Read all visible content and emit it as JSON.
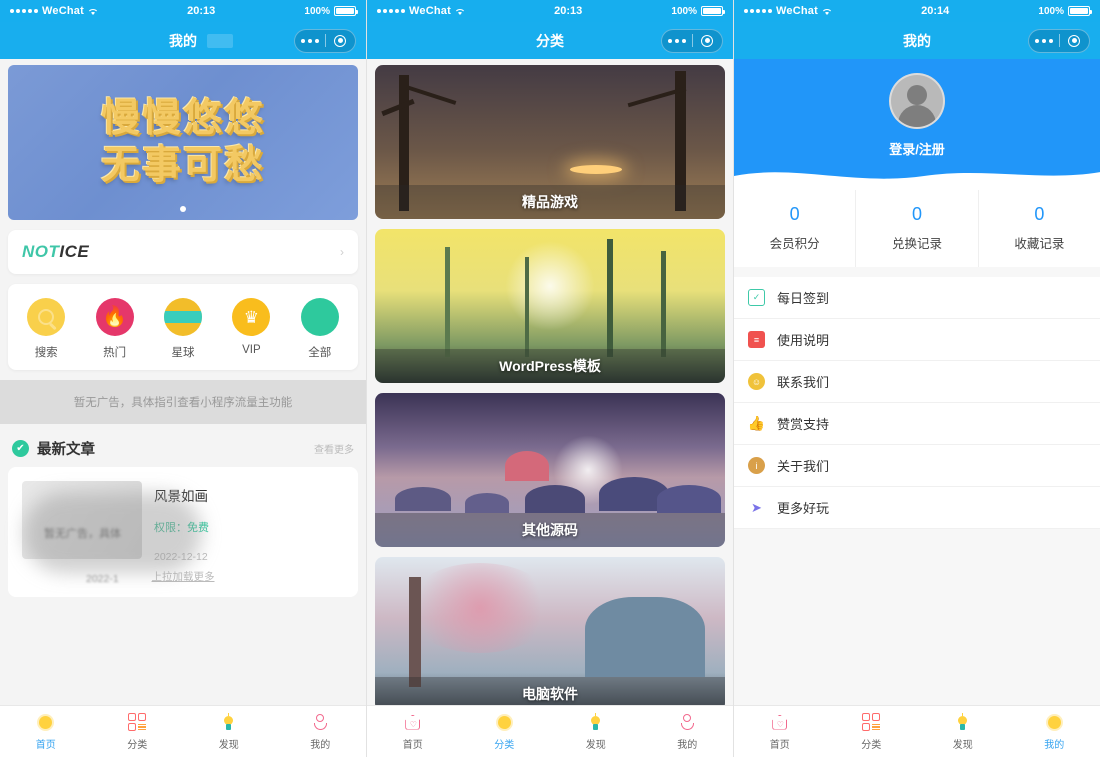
{
  "screens": [
    {
      "status": {
        "carrier": "WeChat",
        "time": "20:13",
        "battery": "100%"
      },
      "nav_title": "我的",
      "banner": {
        "line1": "慢慢悠悠",
        "line2": "无事可愁"
      },
      "notice": {
        "prefix": "NOT",
        "suffix": "ICE"
      },
      "quick_icons": [
        {
          "label": "搜索",
          "icon": "search-icon"
        },
        {
          "label": "热门",
          "icon": "fire-icon"
        },
        {
          "label": "星球",
          "icon": "planet-icon"
        },
        {
          "label": "VIP",
          "icon": "crown-icon"
        },
        {
          "label": "全部",
          "icon": "grid-icon"
        }
      ],
      "ad_text": "暂无广告，具体指引查看小程序流量主功能",
      "section": {
        "title": "最新文章",
        "more": "查看更多"
      },
      "article": {
        "title": "风景如画",
        "meta_label": "权限：",
        "meta_value": "免费",
        "date": "2022-12-12",
        "blur_text": "暂无广告，具体",
        "blur_date": "2022-1",
        "load_more": "上拉加载更多"
      },
      "tabs": [
        {
          "label": "首页",
          "icon": "sun-icon",
          "active": true
        },
        {
          "label": "分类",
          "icon": "grid-icon",
          "active": false
        },
        {
          "label": "发现",
          "icon": "bulb-icon",
          "active": false
        },
        {
          "label": "我的",
          "icon": "person-icon",
          "active": false
        }
      ]
    },
    {
      "status": {
        "carrier": "WeChat",
        "time": "20:13",
        "battery": "100%"
      },
      "nav_title": "分类",
      "categories": [
        {
          "label": "精品游戏"
        },
        {
          "label": "WordPress模板"
        },
        {
          "label": "其他源码"
        },
        {
          "label": "电脑软件"
        },
        {
          "label": ""
        }
      ],
      "tabs": [
        {
          "label": "首页",
          "icon": "home-icon",
          "active": false
        },
        {
          "label": "分类",
          "icon": "sun-icon",
          "active": true
        },
        {
          "label": "发现",
          "icon": "bulb-icon",
          "active": false
        },
        {
          "label": "我的",
          "icon": "person-icon",
          "active": false
        }
      ]
    },
    {
      "status": {
        "carrier": "WeChat",
        "time": "20:14",
        "battery": "100%"
      },
      "nav_title": "我的",
      "profile": {
        "login_label": "登录/注册"
      },
      "stats": [
        {
          "value": "0",
          "label": "会员积分"
        },
        {
          "value": "0",
          "label": "兑换记录"
        },
        {
          "value": "0",
          "label": "收藏记录"
        }
      ],
      "menu": [
        {
          "label": "每日签到",
          "icon": "calendar-check-icon",
          "color": "#3ec9a8"
        },
        {
          "label": "使用说明",
          "icon": "document-icon",
          "color": "#f0524f"
        },
        {
          "label": "联系我们",
          "icon": "chat-icon",
          "color": "#f0c23a"
        },
        {
          "label": "赞赏支持",
          "icon": "thumbs-up-icon",
          "color": "#2ec4d6"
        },
        {
          "label": "关于我们",
          "icon": "info-icon",
          "color": "#d9a04a"
        },
        {
          "label": "更多好玩",
          "icon": "send-icon",
          "color": "#7a73e8"
        }
      ],
      "tabs": [
        {
          "label": "首页",
          "icon": "home-icon",
          "active": false
        },
        {
          "label": "分类",
          "icon": "grid-icon",
          "active": false
        },
        {
          "label": "发现",
          "icon": "bulb-icon",
          "active": false
        },
        {
          "label": "我的",
          "icon": "sun-icon",
          "active": true
        }
      ]
    }
  ],
  "colors": {
    "status_bar": "#17aeee",
    "nav_bar": "#18aeee",
    "profile_header": "#2196f9",
    "accent_blue": "#37a4f0",
    "accent_green": "#2ec99d"
  }
}
